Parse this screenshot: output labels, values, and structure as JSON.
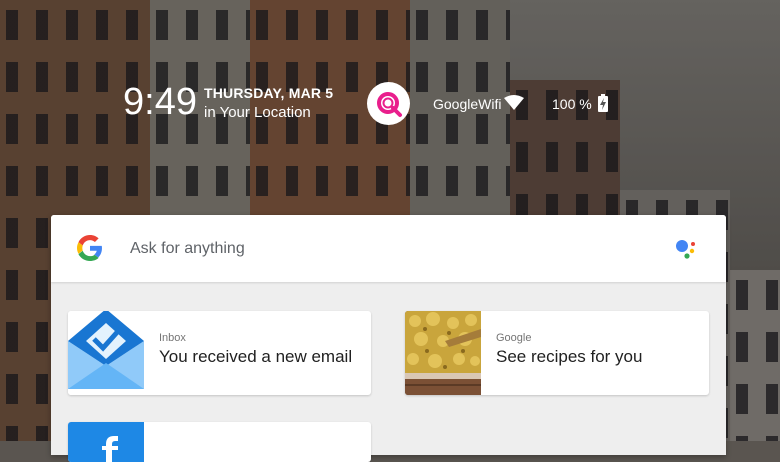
{
  "status": {
    "time": "9:49",
    "date": "THURSDAY, MAR 5",
    "location": "in Your Location",
    "wifi_name": "GoogleWifi",
    "battery": "100 %"
  },
  "search": {
    "placeholder": "Ask for anything"
  },
  "cards": [
    {
      "source": "Inbox",
      "title": "You received a new email",
      "icon": "inbox-envelope-icon"
    },
    {
      "source": "Google",
      "title": "See recipes for you",
      "icon": "recipe-food-photo"
    }
  ],
  "colors": {
    "google_blue": "#4285F4",
    "google_red": "#EA4335",
    "google_yellow": "#FBBC05",
    "google_green": "#34A853",
    "q_icon": "#E91E8C"
  }
}
